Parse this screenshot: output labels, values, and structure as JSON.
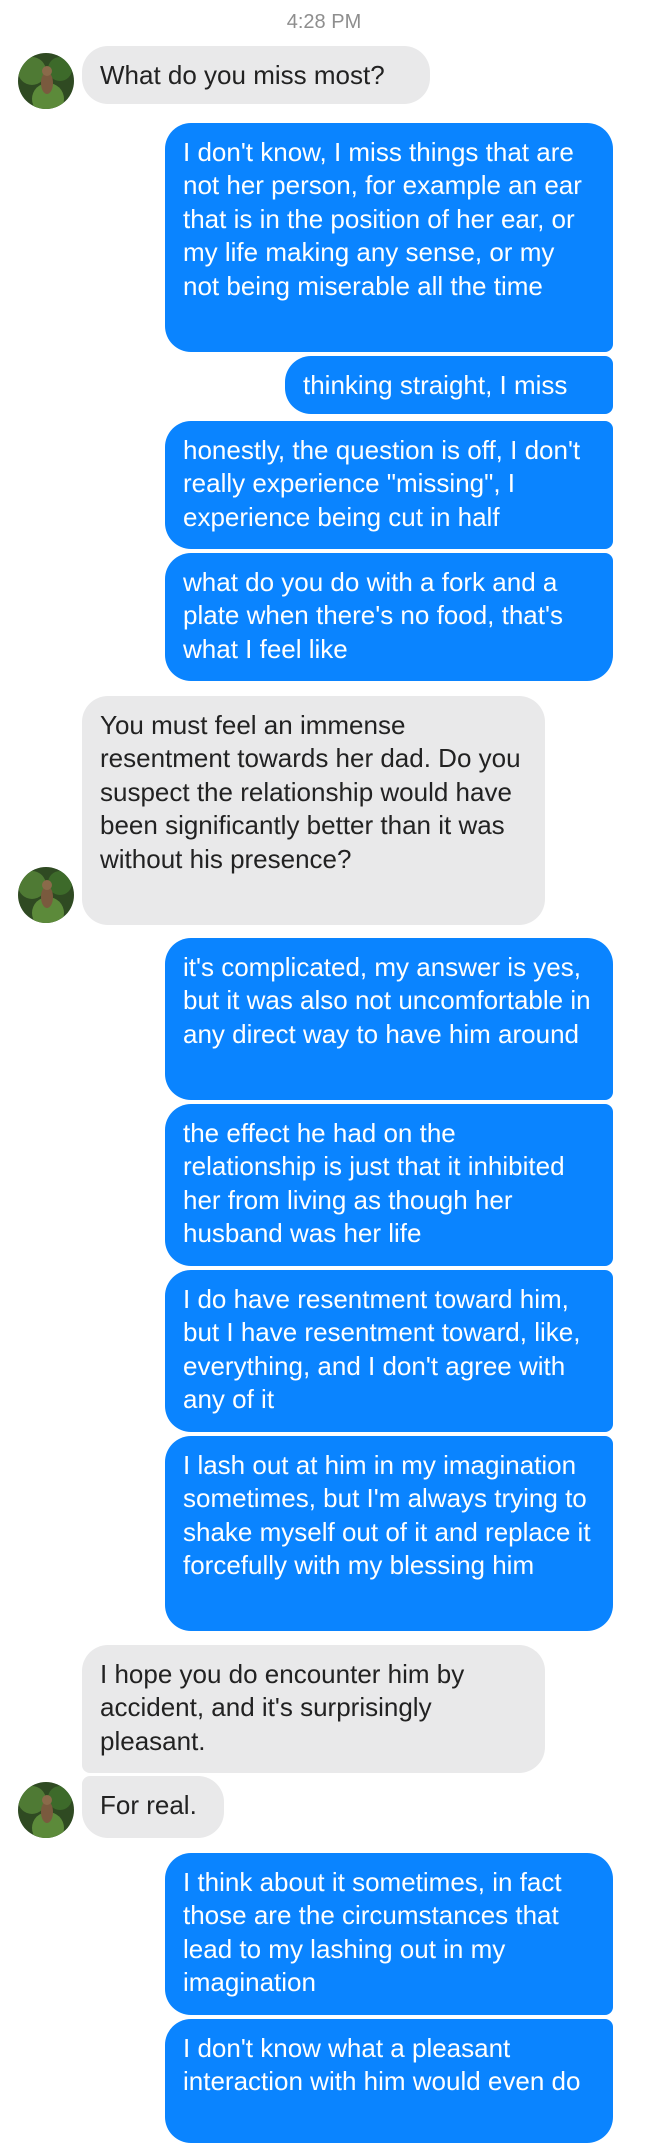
{
  "status": {
    "time": "4:28 PM"
  },
  "contact": {
    "avatar_icon": "contact-avatar-icon"
  },
  "colors": {
    "outgoing_bubble": "#0a84ff",
    "incoming_bubble": "#e9e9ea",
    "outgoing_text": "#ffffff",
    "incoming_text": "#222222",
    "timestamp_text": "#8e8e8e"
  },
  "messages": [
    {
      "direction": "incoming",
      "text": "What do you miss most?"
    },
    {
      "direction": "outgoing",
      "text": "I don't know, I miss things that are not her person, for example an ear that is in the position of her ear, or my life making any sense, or my not being miserable all the time"
    },
    {
      "direction": "outgoing",
      "text": "thinking straight, I miss"
    },
    {
      "direction": "outgoing",
      "text": "honestly, the question is off, I don't really experience \"missing\", I experience being cut in half"
    },
    {
      "direction": "outgoing",
      "text": "what do you do with a fork and a plate when there's no food, that's what I feel like"
    },
    {
      "direction": "incoming",
      "text": "You must feel an immense resentment towards her dad. Do you suspect the relationship would have been significantly better than it was without his presence?"
    },
    {
      "direction": "outgoing",
      "text": "it's complicated, my answer is yes, but it was also not uncomfortable in any direct way to have him around"
    },
    {
      "direction": "outgoing",
      "text": "the effect he had on the relationship is just that it inhibited her from living as though her husband was her life"
    },
    {
      "direction": "outgoing",
      "text": "I do have resentment toward him, but I have resentment toward, like, everything, and I don't agree with any of it"
    },
    {
      "direction": "outgoing",
      "text": "I lash out at him in my imagination sometimes, but I'm always trying to shake myself out of it and replace it forcefully with my blessing him"
    },
    {
      "direction": "incoming",
      "text": "I hope you do encounter him by accident, and it's surprisingly pleasant."
    },
    {
      "direction": "incoming",
      "text": "For real."
    },
    {
      "direction": "outgoing",
      "text": "I think about it sometimes, in fact those are the circumstances that lead to my lashing out in my imagination"
    },
    {
      "direction": "outgoing",
      "text": "I don't know what a pleasant interaction with him would even do"
    }
  ]
}
